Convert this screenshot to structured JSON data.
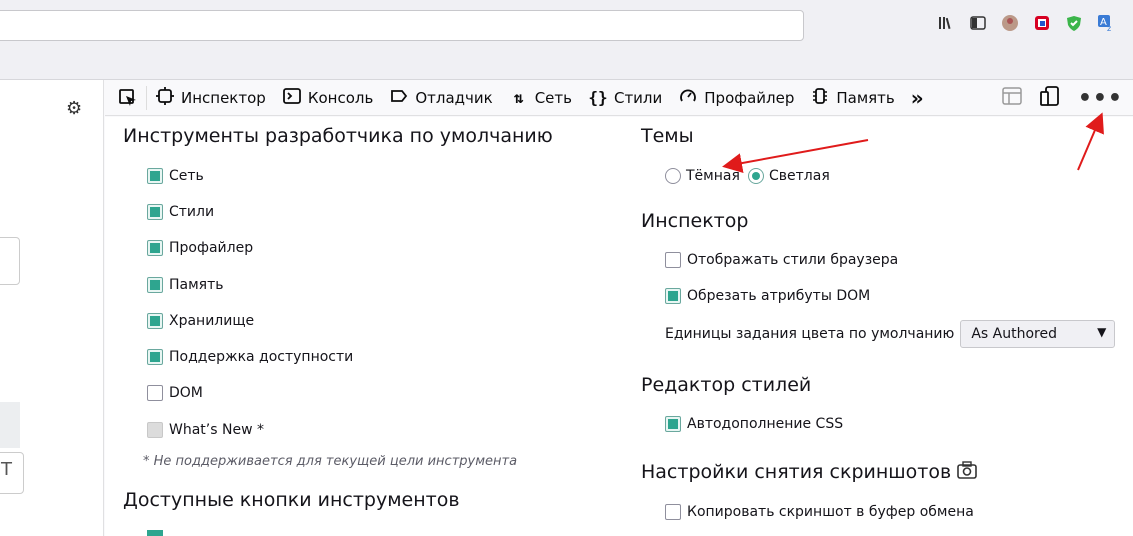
{
  "toolbar": {
    "inspector": "Инспектор",
    "console": "Консоль",
    "debugger": "Отладчик",
    "network": "Сеть",
    "styles": "Стили",
    "profiler": "Профайлер",
    "memory": "Память"
  },
  "left": {
    "default_tools_title": "Инструменты разработчика по умолчанию",
    "tools": [
      {
        "label": "Сеть",
        "checked": true
      },
      {
        "label": "Стили",
        "checked": true
      },
      {
        "label": "Профайлер",
        "checked": true
      },
      {
        "label": "Память",
        "checked": true
      },
      {
        "label": "Хранилище",
        "checked": true
      },
      {
        "label": "Поддержка доступности",
        "checked": true
      },
      {
        "label": "DOM",
        "checked": false
      },
      {
        "label": "What’s New *",
        "checked": false
      }
    ],
    "not_supported_note": "* Не поддерживается для текущей цели инструмента",
    "buttons_title": "Доступные кнопки инструментов"
  },
  "right": {
    "themes_title": "Темы",
    "theme_dark": "Тёмная",
    "theme_light": "Светлая",
    "inspector_title": "Инспектор",
    "show_browser_styles": "Отображать стили браузера",
    "truncate_dom": "Обрезать атрибуты DOM",
    "color_units_label": "Единицы задания цвета по умолчанию",
    "color_units_value": "As Authored",
    "style_editor_title": "Редактор стилей",
    "autocomplete_css": "Автодополнение CSS",
    "screenshot_title": "Настройки снятия скриншотов",
    "copy_screenshot": "Копировать скриншот в буфер обмена"
  },
  "colors": {
    "accent": "#2ea58f",
    "annotation_arrow": "#e01b1b"
  }
}
